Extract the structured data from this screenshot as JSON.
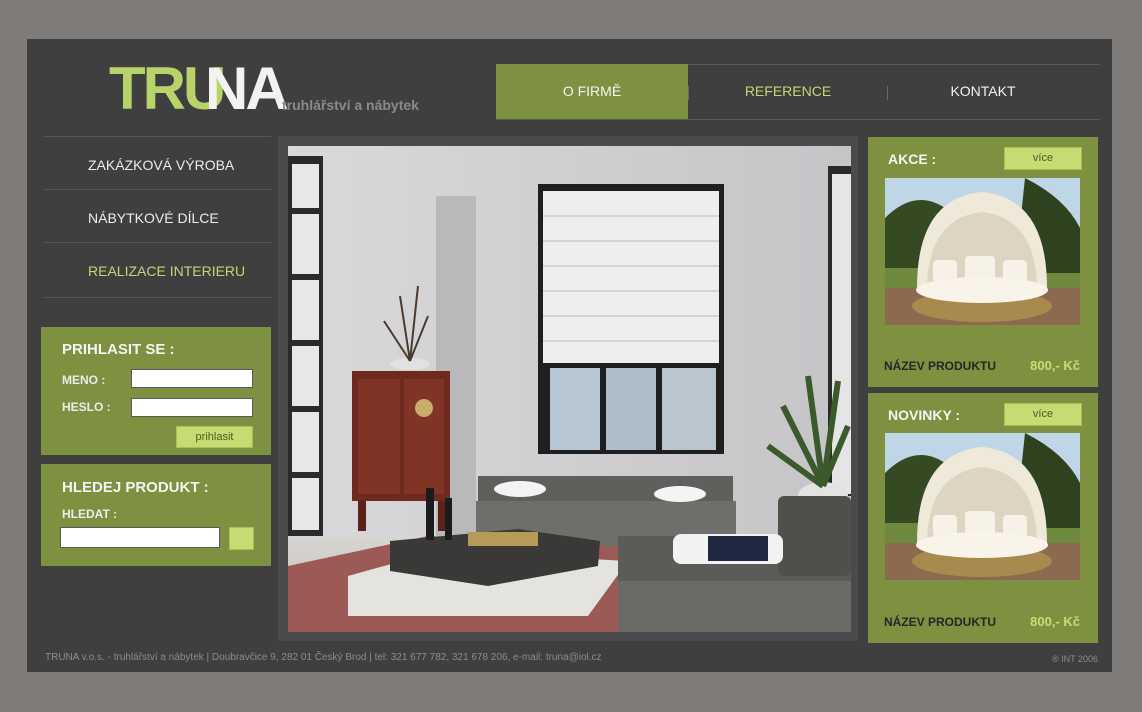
{
  "logo": {
    "part1": "TRU",
    "part2": "NA",
    "tagline": "truhlářství a nábytek"
  },
  "topnav": [
    {
      "label": "O FIRMĚ"
    },
    {
      "label": "REFERENCE"
    },
    {
      "label": "KONTAKT"
    }
  ],
  "leftmenu": [
    {
      "label": "ZAKÁZKOVÁ VÝROBA"
    },
    {
      "label": "NÁBYTKOVÉ DÍLCE"
    },
    {
      "label": "REALIZACE INTERIERU"
    }
  ],
  "login": {
    "title": "PRIHLASIT SE :",
    "name_label": "MENO :",
    "password_label": "HESLO :",
    "name_value": "",
    "password_value": "",
    "submit_label": "prihlasit"
  },
  "search": {
    "title": "HLEDEJ PRODUKT :",
    "label": "HLEDAT :",
    "value": ""
  },
  "akce": {
    "title": "AKCE :",
    "more_label": "více",
    "product_name": "NÁZEV PRODUKTU",
    "price": "800,- Kč"
  },
  "novinky": {
    "title": "NOVINKY :",
    "more_label": "více",
    "product_name": "NÁZEV PRODUKTU",
    "price": "800,- Kč"
  },
  "footer": {
    "text": "TRUNA v.o.s. - truhlářství a nábytek | Doubravčice 9, 282 01 Český Brod | tel: 321 677 782, 321 678 206, e-mail: truna@iol.cz",
    "copyright": "® INT 2006"
  },
  "colors": {
    "background": "#7f7b79",
    "frame": "#3f3f40",
    "green": "#7d9140",
    "lime": "#c6dc72",
    "logo_lime": "#b8d36a"
  }
}
